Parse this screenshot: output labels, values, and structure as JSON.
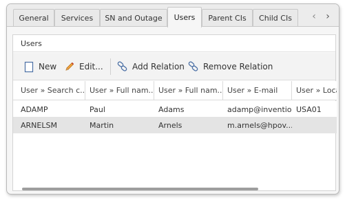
{
  "tabs": [
    {
      "label": "General"
    },
    {
      "label": "Services"
    },
    {
      "label": "SN and Outage"
    },
    {
      "label": "Users",
      "active": true
    },
    {
      "label": "Parent CIs"
    },
    {
      "label": "Child CIs"
    }
  ],
  "panel": {
    "title": "Users"
  },
  "toolbar": {
    "new_label": "New",
    "edit_label": "Edit...",
    "add_relation_label": "Add Relation",
    "remove_relation_label": "Remove Relation"
  },
  "table": {
    "columns": [
      "User » Search c...",
      "User » Full nam...",
      "User » Full nam...",
      "User » E-mail",
      "User » Location"
    ],
    "rows": [
      [
        "ADAMP",
        "Paul",
        "Adams",
        "adamp@inventio...",
        "USA01"
      ],
      [
        "ARNELSM",
        "Martin",
        "Arnels",
        "m.arnels@hpov....",
        ""
      ]
    ]
  },
  "colors": {
    "selected_row": "#e4e4e4",
    "accent_blue": "#4a6fa5"
  }
}
